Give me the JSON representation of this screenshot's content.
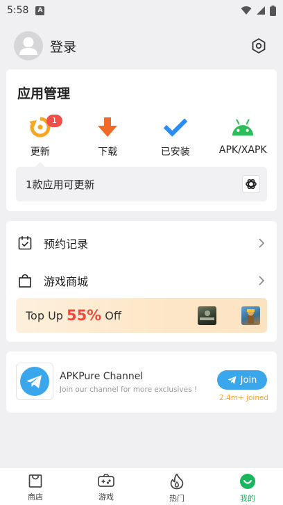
{
  "status": {
    "time": "5:58",
    "notif_letter": "A"
  },
  "header": {
    "login": "登录"
  },
  "app_management": {
    "title": "应用管理",
    "items": [
      {
        "label": "更新",
        "icon": "refresh-icon",
        "badge": "1"
      },
      {
        "label": "下载",
        "icon": "download-arrow-icon"
      },
      {
        "label": "已安装",
        "icon": "checkmark-icon"
      },
      {
        "label": "APK/XAPK",
        "icon": "android-icon"
      }
    ],
    "update_notice": "1款应用可更新"
  },
  "links": [
    {
      "label": "预约记录",
      "icon": "calendar-check-icon"
    },
    {
      "label": "游戏商城",
      "icon": "shopping-bag-icon"
    }
  ],
  "promo": {
    "prefix": "Top Up",
    "percent": "55%",
    "suffix": "Off"
  },
  "channel": {
    "title": "APKPure Channel",
    "subtitle": "Join our channel for more exclusives !",
    "join_label": "Join",
    "joined_count": "2.4m+ joined"
  },
  "bottom_nav": [
    {
      "label": "商店",
      "icon": "store-icon"
    },
    {
      "label": "游戏",
      "icon": "gamepad-icon"
    },
    {
      "label": "热门",
      "icon": "flame-icon"
    },
    {
      "label": "我的",
      "icon": "profile-smile-icon",
      "active": true
    }
  ],
  "colors": {
    "accent_green": "#19b55f",
    "badge_red": "#f0504a",
    "update_orange": "#f5a623",
    "download_orange": "#f26a2a",
    "installed_blue": "#2d8cf0",
    "android_green": "#2dbd5a",
    "telegram_blue": "#3aa6ec"
  }
}
